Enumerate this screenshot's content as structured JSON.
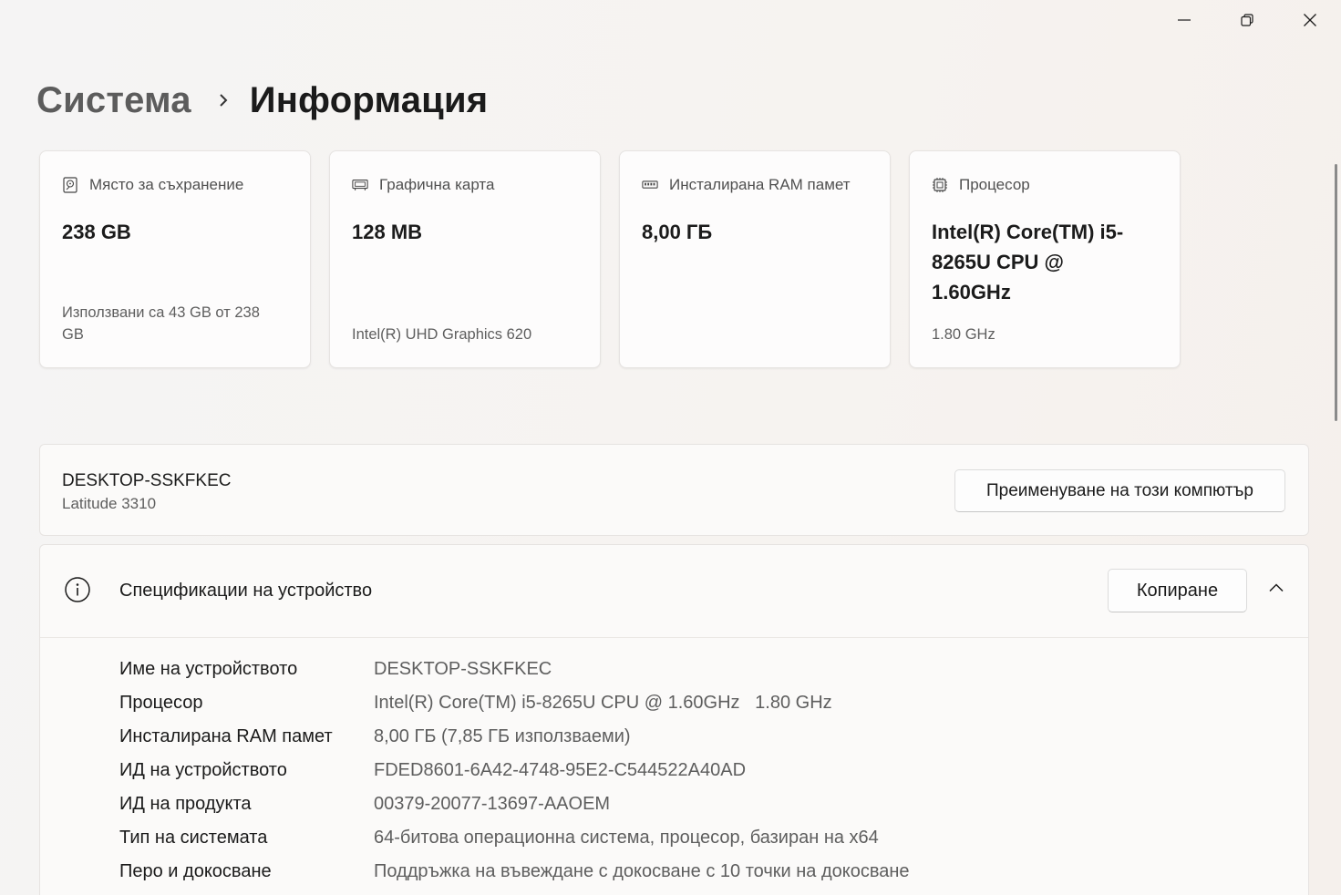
{
  "window": {
    "controls": [
      "minimize",
      "restore",
      "close"
    ]
  },
  "breadcrumb": {
    "parent": "Система",
    "current": "Информация"
  },
  "cards": [
    {
      "icon": "storage-icon",
      "label": "Място за съхранение",
      "value": "238 GB",
      "sub": "Използвани са 43 GB от 238 GB"
    },
    {
      "icon": "graphics-card-icon",
      "label": "Графична карта",
      "value": "128 MB",
      "sub": "Intel(R) UHD Graphics 620"
    },
    {
      "icon": "ram-icon",
      "label": "Инсталирана RAM памет",
      "value": "8,00 ГБ",
      "sub": ""
    },
    {
      "icon": "processor-icon",
      "label": "Процесор",
      "value": "Intel(R) Core(TM) i5-8265U CPU @ 1.60GHz",
      "sub": "1.80 GHz"
    }
  ],
  "device": {
    "name": "DESKTOP-SSKFKEC",
    "model": "Latitude 3310",
    "rename_label": "Преименуване на този компютър"
  },
  "specs": {
    "title": "Спецификации на устройство",
    "copy_label": "Копиране",
    "rows": [
      {
        "key": "Име на устройството",
        "value": "DESKTOP-SSKFKEC"
      },
      {
        "key": "Процесор",
        "value": "Intel(R) Core(TM) i5-8265U CPU @ 1.60GHz   1.80 GHz"
      },
      {
        "key": "Инсталирана RAM памет",
        "value": "8,00 ГБ (7,85 ГБ използваеми)"
      },
      {
        "key": "ИД на устройството",
        "value": "FDED8601-6A42-4748-95E2-C544522A40AD"
      },
      {
        "key": "ИД на продукта",
        "value": "00379-20077-13697-AAOEM"
      },
      {
        "key": "Тип на системата",
        "value": "64-битова операционна система, процесор, базиран на x64"
      },
      {
        "key": "Перо и докосване",
        "value": "Поддръжка на въвеждане с докосване с 10 точки на докосване"
      }
    ]
  }
}
